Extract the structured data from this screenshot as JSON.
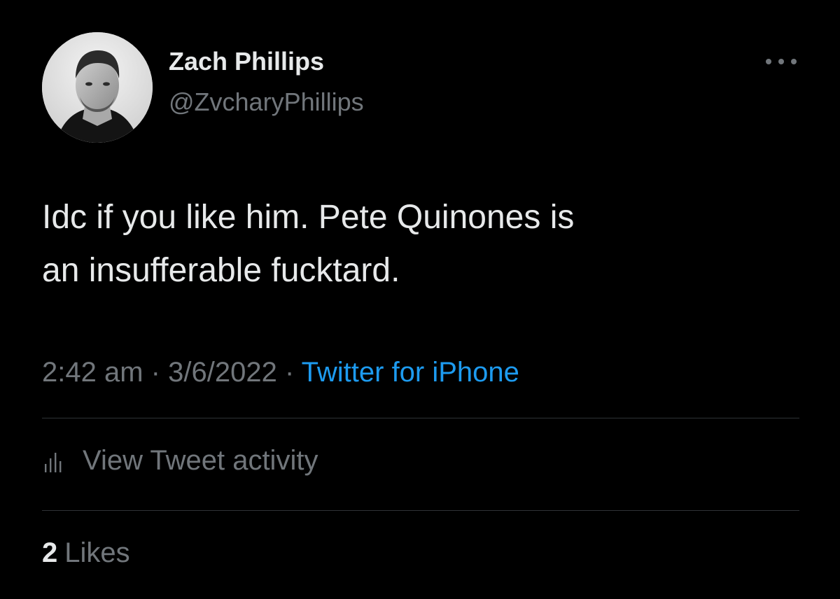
{
  "author": {
    "name": "Zach Phillips",
    "handle": "@ZvcharyPhillips",
    "avatar": "profile-photo"
  },
  "tweet": {
    "text_lines": [
      "Idc if you like him. Pete Quinones is",
      "an insufferable fucktard."
    ]
  },
  "meta": {
    "time": "2:42 am",
    "separator": "·",
    "date": "3/6/2022",
    "source": "Twitter for iPhone"
  },
  "activity": {
    "icon": "bar-chart-icon",
    "label": "View Tweet activity"
  },
  "likes": {
    "count": "2",
    "label": "Likes"
  },
  "menu": {
    "icon": "more-options-icon"
  },
  "colors": {
    "background": "#000000",
    "primary_text": "#e7e9ea",
    "secondary_text": "#71767b",
    "link": "#1d9bf0",
    "divider": "#2f3336"
  }
}
